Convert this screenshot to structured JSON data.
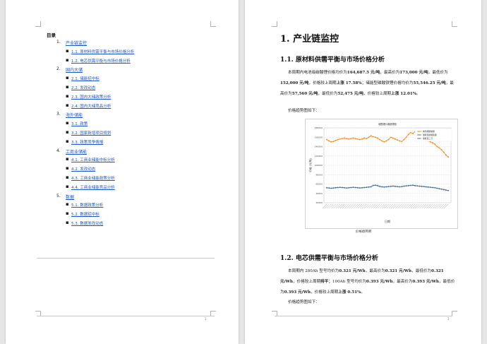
{
  "page1": {
    "toc_title": "目录",
    "sections": [
      {
        "num": "1.",
        "label": "产业链监控",
        "subs": [
          "1.1. 原材料供需平衡与市场价格分析",
          "1.2. 电芯供需平衡与市场价格分析"
        ]
      },
      {
        "num": "2.",
        "label": "国内大储",
        "subs": [
          "2.1. 储能招中标",
          "2.2. 发改动态",
          "2.3. 国内大储政策分析",
          "2.4. 国内大储竞品分析"
        ]
      },
      {
        "num": "3.",
        "label": "海外储能",
        "subs": [
          "3.1. 政策",
          "3.2. 国家新增项目规划",
          "3.3. 政策竞争情报"
        ]
      },
      {
        "num": "4.",
        "label": "工商业储能",
        "subs": [
          "4.1. 工商业储能中标分析",
          "4.2. 发改动态",
          "4.3. 工商业储能政策分析",
          "4.4. 工商业储能竞品分析"
        ]
      },
      {
        "num": "5.",
        "label": "数据",
        "subs": [
          "5.1. 数据政策分析",
          "5.2. 数据招中标",
          "5.3. 数据发改动态"
        ]
      }
    ],
    "page_number": "1"
  },
  "page2": {
    "h1": "1. 产业链监控",
    "h2_1": "1.1. 原材料供需平衡与市场价格分析",
    "para1": {
      "a": "本周期内电池级碳酸锂价格均价为",
      "v1": "164,687.5 元/吨",
      "b": "，最高价为",
      "v2": "173,000 元/吨",
      "c": "，最低价为",
      "v3": "152,000 元/吨",
      "d": "，价格较上周期",
      "v4": "上涨 17.58%",
      "e": "；储能型磷酸铁锂价格均价为",
      "v5": "55,546.25 元/吨",
      "f": "，最高价为",
      "v6": "57,560 元/吨",
      "g": "，最低价为",
      "v7": "52,475 元/吨",
      "h": "，价格较上周期",
      "v8": "上涨 12.01%",
      "i": "。"
    },
    "trend_label_1": "价格趋势图如下：",
    "caption": "价格趋势图",
    "h2_2": "1.2. 电芯供需平衡与市场价格分析",
    "para2": {
      "a": "本周期内 280Ah 型号均价为",
      "v1": "0.321 元/Wh",
      "b": "，最高价为",
      "v2": "0.321 元/Wh",
      "c": "，最低价为",
      "v3": "0.321 元/Wh",
      "d": "，价格较上周期",
      "v4": "持平",
      "e": "；100Ah 型号均价为",
      "v5": "0.393 元/Wh",
      "f": "，最高价为",
      "v6": "0.393 元/Wh",
      "g": "，最低价为",
      "v7": "0.393 元/Wh",
      "h": "，价格较上周期",
      "v8": "上涨 0.51%",
      "i": "。"
    },
    "trend_label_2": "价格趋势图如下：",
    "page_number": "2"
  },
  "chart_data": {
    "type": "line",
    "title": "碳酸锂价格趋势图",
    "xlabel": "日期",
    "ylabel": "价格 (元/吨)",
    "ylim": [
      20000,
      180000
    ],
    "yticks": [
      20000,
      40000,
      60000,
      80000,
      100000,
      120000,
      140000,
      160000,
      180000
    ],
    "grid": true,
    "legend_position": "top-right",
    "series": [
      {
        "name": "电池级碳酸锂",
        "color": "#ff7f0e",
        "values": [
          155000,
          152000,
          150000,
          151000,
          153000,
          155000,
          156000,
          157000,
          158000,
          157000,
          156000,
          157000,
          158000,
          157000,
          156000,
          155000,
          156000,
          158000,
          157000,
          160000,
          163000,
          161000,
          160000,
          158000,
          155000,
          152000,
          150000,
          152000,
          155000,
          160000,
          158000,
          156000,
          154000,
          152000,
          151000,
          155000,
          160000,
          166000,
          170000,
          168000,
          172000,
          173000,
          165000,
          160000,
          158000,
          156000,
          152000,
          150000,
          148000,
          145000,
          140000,
          137000,
          133000,
          128000,
          122000,
          118000
        ]
      },
      {
        "name": "储能型磷酸铁锂",
        "color": "#2e8b57",
        "values": [
          52000,
          51500,
          51000,
          51500,
          52000,
          52500,
          53000,
          52500,
          52000,
          51500,
          52000,
          52500,
          53000,
          52500,
          52000,
          51500,
          52000,
          52500,
          53000,
          53500,
          54000,
          57000,
          57500,
          56500,
          55000,
          54000,
          53500,
          54000,
          54500,
          55000,
          55500,
          55000,
          54500,
          54000,
          54500,
          55500,
          56000,
          56500,
          57000,
          57560,
          56500,
          56000,
          55500,
          55000,
          54500,
          54000,
          53500,
          53000,
          52475,
          52000,
          51000,
          50000,
          49000,
          48000,
          47000,
          46000
        ]
      },
      {
        "name": "储能型三元",
        "color": "#4a6fa5",
        "values": [
          52000,
          51500,
          51000,
          51500,
          52000,
          52500,
          53000,
          52500,
          52000,
          51500,
          52000,
          52500,
          53000,
          52500,
          52000,
          51500,
          52000,
          52500,
          53000,
          53500,
          54000,
          57000,
          57500,
          56500,
          55000,
          54000,
          53500,
          54000,
          54500,
          55000,
          55500,
          55000,
          54500,
          54000,
          54500,
          55500,
          56000,
          56500,
          57000,
          57560,
          56500,
          56000,
          55500,
          55000,
          54500,
          54000,
          53500,
          53000,
          52475,
          52000,
          51000,
          50000,
          49000,
          48000,
          47000,
          46000
        ]
      }
    ]
  }
}
